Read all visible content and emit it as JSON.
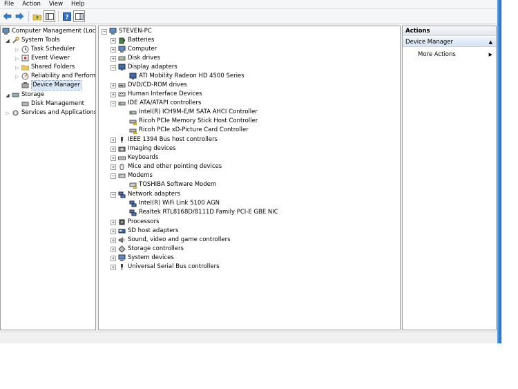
{
  "menubar": {
    "items": [
      "File",
      "Action",
      "View",
      "Help"
    ]
  },
  "toolbar": {
    "buttons": [
      "back-arrow-icon",
      "forward-arrow-icon",
      "up-folder-icon",
      "show-hide-tree-icon",
      "help-icon",
      "properties-icon"
    ]
  },
  "left_tree": {
    "root": "Computer Management (Local",
    "system_tools": "System Tools",
    "task_scheduler": "Task Scheduler",
    "event_viewer": "Event Viewer",
    "shared_folders": "Shared Folders",
    "reliability": "Reliability and Performa",
    "device_manager": "Device Manager",
    "storage": "Storage",
    "disk_management": "Disk Management",
    "services_apps": "Services and Applications"
  },
  "scroll": {
    "left": "◂",
    "right": "▸",
    "thumb": "|||"
  },
  "device_tree": {
    "root": "STEVEN-PC",
    "batteries": "Batteries",
    "computer": "Computer",
    "disk_drives": "Disk drives",
    "display_adapters": "Display adapters",
    "ati": "ATI Mobility Radeon HD 4500 Series",
    "dvd": "DVD/CD-ROM drives",
    "hid": "Human Interface Devices",
    "ide": "IDE ATA/ATAPI controllers",
    "intel_sata": "Intel(R) ICH9M-E/M SATA AHCI Controller",
    "ricoh_ms": "Ricoh PCIe Memory Stick Host Controller",
    "ricoh_xd": "Ricoh PCIe xD-Picture Card Controller",
    "ieee1394": "IEEE 1394 Bus host controllers",
    "imaging": "Imaging devices",
    "keyboards": "Keyboards",
    "mice": "Mice and other pointing devices",
    "modems": "Modems",
    "toshiba_modem": "TOSHIBA Software Modem",
    "network": "Network adapters",
    "intel_wifi": "Intel(R) WiFi Link 5100 AGN",
    "realtek": "Realtek RTL8168D/8111D Family PCI-E GBE NIC",
    "processors": "Processors",
    "sd_host": "SD host adapters",
    "sound": "Sound, video and game controllers",
    "storage_ctrl": "Storage controllers",
    "system_devices": "System devices",
    "usb": "Universal Serial Bus controllers"
  },
  "actions": {
    "header": "Actions",
    "group": "Device Manager",
    "more_actions": "More Actions"
  },
  "colors": {
    "selection": "#d9e8f7",
    "window_bg": "#f0f0f0",
    "accent": "#1a62c4"
  }
}
